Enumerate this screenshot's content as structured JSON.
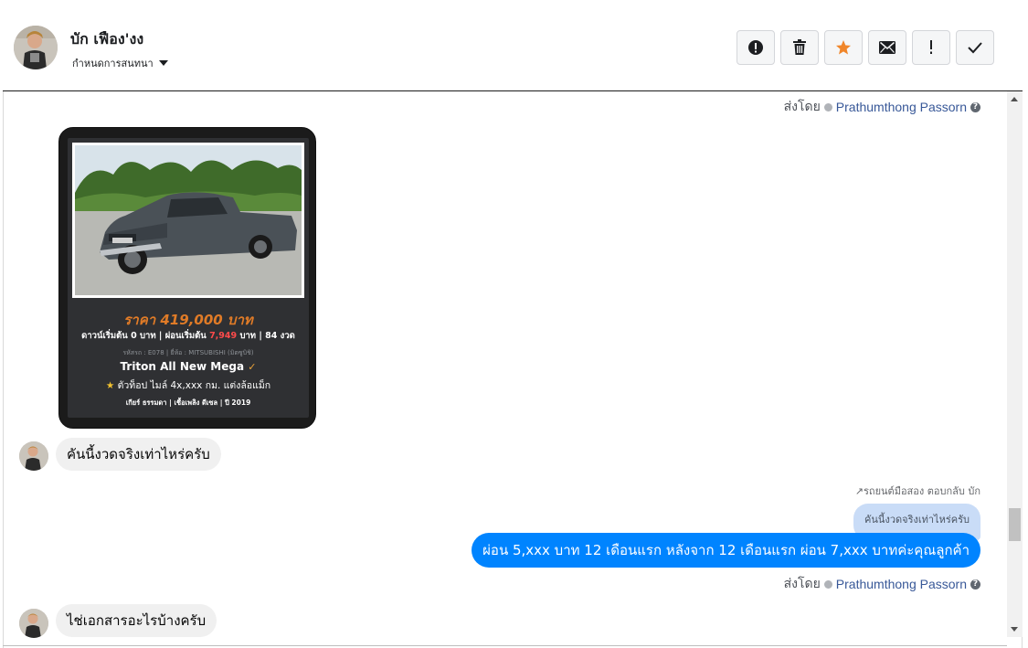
{
  "header": {
    "contact_name": "บัก เฟือง'งง",
    "assign_label": "กำหนดการสนทนา",
    "actions": [
      {
        "name": "spam-icon",
        "glyph": "!"
      },
      {
        "name": "trash-icon",
        "glyph": "🗑"
      },
      {
        "name": "star-icon",
        "glyph": "★"
      },
      {
        "name": "envelope-icon",
        "glyph": "✉"
      },
      {
        "name": "important-icon",
        "glyph": "!"
      },
      {
        "name": "check-icon",
        "glyph": "✓"
      }
    ],
    "star_color": "#f0862a"
  },
  "sent_by": {
    "prefix": "ส่งโดย",
    "agent": "Prathumthong Passorn",
    "help": "?"
  },
  "car_card": {
    "price": "ราคา 419,000 บาท",
    "finance_a": "ดาวน์เริ่มต้น 0 บาท | ผ่อนเริ่มต้น",
    "finance_amount": "7,949",
    "finance_b": "บาท | 84 งวด",
    "meta": "รหัสรถ : E078 | ยี่ห้อ : MITSUBISHI (มิตซูบิชิ)",
    "model": "Triton All New Mega",
    "feature": "ตัวท็อป ไมล์ 4x,xxx กม. แต่งล้อแม็ก",
    "specs": "เกียร์ ธรรมดา  |  เชื้อเพลิง ดีเซล  |  ปี 2019"
  },
  "messages": {
    "incoming_1": "คันนี้งวดจริงเท่าไหร่ครับ",
    "reply_label": "รถยนต์มือสอง ตอบกลับ บัก",
    "quoted": "คันนี้งวดจริงเท่าไหร่ครับ",
    "outgoing_1": "ผ่อน 5,xxx บาท 12 เดือนแรก หลังจาก 12 เดือนแรก ผ่อน 7,xxx บาทค่ะคุณลูกค้า",
    "incoming_2": "ไช่เอกสารอะไรบ้างครับ"
  }
}
